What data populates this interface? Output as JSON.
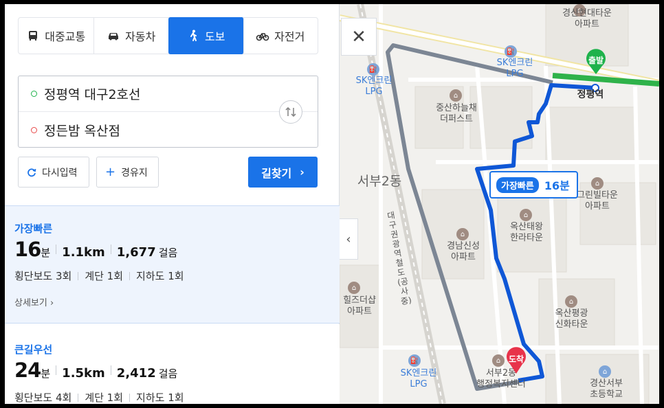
{
  "modes": [
    {
      "label": "대중교통",
      "icon": "bus-icon",
      "active": false
    },
    {
      "label": "자동차",
      "icon": "car-icon",
      "active": false
    },
    {
      "label": "도보",
      "icon": "walk-icon",
      "active": true
    },
    {
      "label": "자전거",
      "icon": "bike-icon",
      "active": false
    }
  ],
  "origin": "정평역 대구2호선",
  "destination": "정든밤 옥산점",
  "actions": {
    "reset": "다시입력",
    "waypoint": "경유지",
    "search": "길찾기"
  },
  "routes": [
    {
      "tag": "가장빠른",
      "minutes": "16",
      "minutes_unit": "분",
      "distance": "1.1km",
      "steps": "1,677",
      "steps_unit": "걸음",
      "details": [
        "횡단보도 3회",
        "계단 1회",
        "지하도 1회"
      ],
      "more": "상세보기"
    },
    {
      "tag": "큰길우선",
      "minutes": "24",
      "minutes_unit": "분",
      "distance": "1.5km",
      "steps": "2,412",
      "steps_unit": "걸음",
      "details": [
        "횡단보도 4회",
        "계단 1회",
        "지하도 1회"
      ]
    }
  ],
  "map": {
    "badge_tag": "가장빠른",
    "badge_time": "16분",
    "start_pin": "출발",
    "end_pin": "도착",
    "labels": {
      "apt1": "경산현대타운\n아파트",
      "sk1": "SK엔크린\nLPG",
      "sk2": "SK엔크린\nLPG",
      "sk3": "SK엔크린\nLPG",
      "station": "정평역",
      "hanul": "중산하늘채\n더퍼스트",
      "district": "서부2동",
      "railway": "대구권광역철도(공사중)",
      "green": "그린빌타운\n아파트",
      "oksan": "옥산태왕\n한라타운",
      "gyeongnam": "경남신성\n아파트",
      "hills": "힐즈더샵\n아파트",
      "oksanpy": "옥산평광\n신화타운",
      "welfare": "서부2동\n행정복지센터",
      "school": "경산서부\n초등학교"
    }
  },
  "colors": {
    "accent": "#1a73e8",
    "start": "#1eb24b",
    "end": "#e8334a"
  }
}
